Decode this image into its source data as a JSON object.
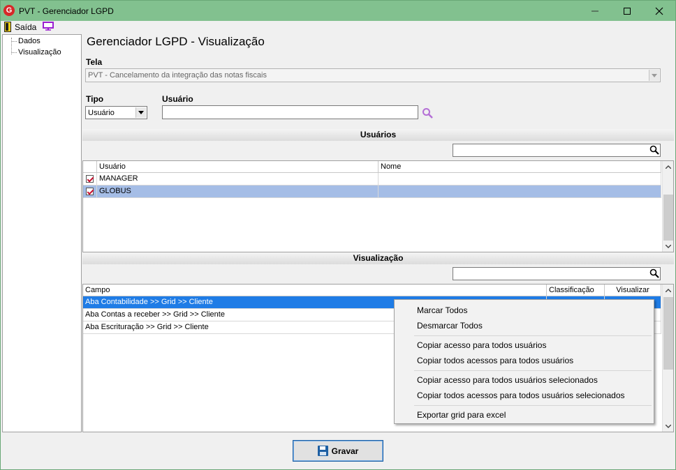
{
  "window": {
    "title": "PVT - Gerenciador LGPD",
    "app_icon": "G"
  },
  "menubar": {
    "exit_label": "Saída"
  },
  "tree": {
    "items": [
      "Dados",
      "Visualização"
    ]
  },
  "page_title": "Gerenciador LGPD - Visualização",
  "tela": {
    "label": "Tela",
    "value": "PVT - Cancelamento da integração das notas fiscais"
  },
  "tipo": {
    "label": "Tipo",
    "value": "Usuário"
  },
  "usuario": {
    "label": "Usuário",
    "value": ""
  },
  "usuarios_section": {
    "title": "Usuários",
    "search_value": "",
    "columns": [
      "Usuário",
      "Nome"
    ],
    "rows": [
      {
        "usuario": "MANAGER",
        "nome": "",
        "checked": true
      },
      {
        "usuario": "GLOBUS",
        "nome": "",
        "checked": true
      }
    ]
  },
  "visualizacao_section": {
    "title": "Visualização",
    "search_value": "",
    "columns": [
      "Campo",
      "Classificação",
      "Visualizar"
    ],
    "rows": [
      {
        "campo": "Aba Contabilidade >> Grid >> Cliente"
      },
      {
        "campo": "Aba Contas a receber >> Grid >> Cliente"
      },
      {
        "campo": "Aba Escrituração >> Grid >> Cliente"
      }
    ]
  },
  "context_menu": {
    "items": [
      "Marcar Todos",
      "Desmarcar Todos",
      "Copiar acesso para todos usuários",
      "Copiar todos acessos para todos usuários",
      "Copiar acesso para todos usuários selecionados",
      "Copiar todos acessos para todos usuários selecionados",
      "Exportar grid para excel"
    ]
  },
  "save_button": {
    "label": "Gravar"
  },
  "colors": {
    "titlebar": "#82c18f",
    "selection_blue": "#1f7ce6",
    "selection_light": "#a5bde6",
    "check_red": "#c8102e"
  }
}
